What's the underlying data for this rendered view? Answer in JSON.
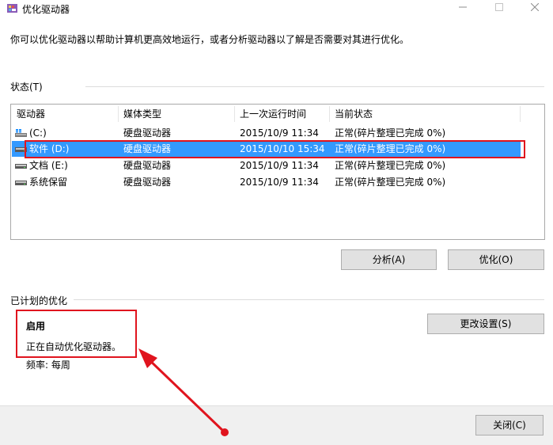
{
  "window": {
    "title": "优化驱动器"
  },
  "description": "你可以优化驱动器以帮助计算机更高效地运行，或者分析驱动器以了解是否需要对其进行优化。",
  "status_group": {
    "label": "状态(T)"
  },
  "table": {
    "columns": [
      "驱动器",
      "媒体类型",
      "上一次运行时间",
      "当前状态"
    ],
    "rows": [
      {
        "drive": "(C:)",
        "media": "硬盘驱动器",
        "last_run": "2015/10/9 11:34",
        "status": "正常(碎片整理已完成 0%)",
        "icon": "windows-drive-icon"
      },
      {
        "drive": "软件 (D:)",
        "media": "硬盘驱动器",
        "last_run": "2015/10/10 15:34",
        "status": "正常(碎片整理已完成 0%)",
        "icon": "hard-drive-icon"
      },
      {
        "drive": "文档 (E:)",
        "media": "硬盘驱动器",
        "last_run": "2015/10/9 11:34",
        "status": "正常(碎片整理已完成 0%)",
        "icon": "hard-drive-icon"
      },
      {
        "drive": "系统保留",
        "media": "硬盘驱动器",
        "last_run": "2015/10/9 11:34",
        "status": "正常(碎片整理已完成 0%)",
        "icon": "hard-drive-icon"
      }
    ]
  },
  "buttons": {
    "analyze": "分析(A)",
    "optimize": "优化(O)",
    "change_settings": "更改设置(S)",
    "close": "关闭(C)"
  },
  "scheduled": {
    "label": "已计划的优化",
    "status": "启用",
    "desc": "正在自动优化驱动器。",
    "frequency": "频率: 每周"
  },
  "colors": {
    "selection": "#3399ff",
    "annotation": "#e0141e"
  }
}
